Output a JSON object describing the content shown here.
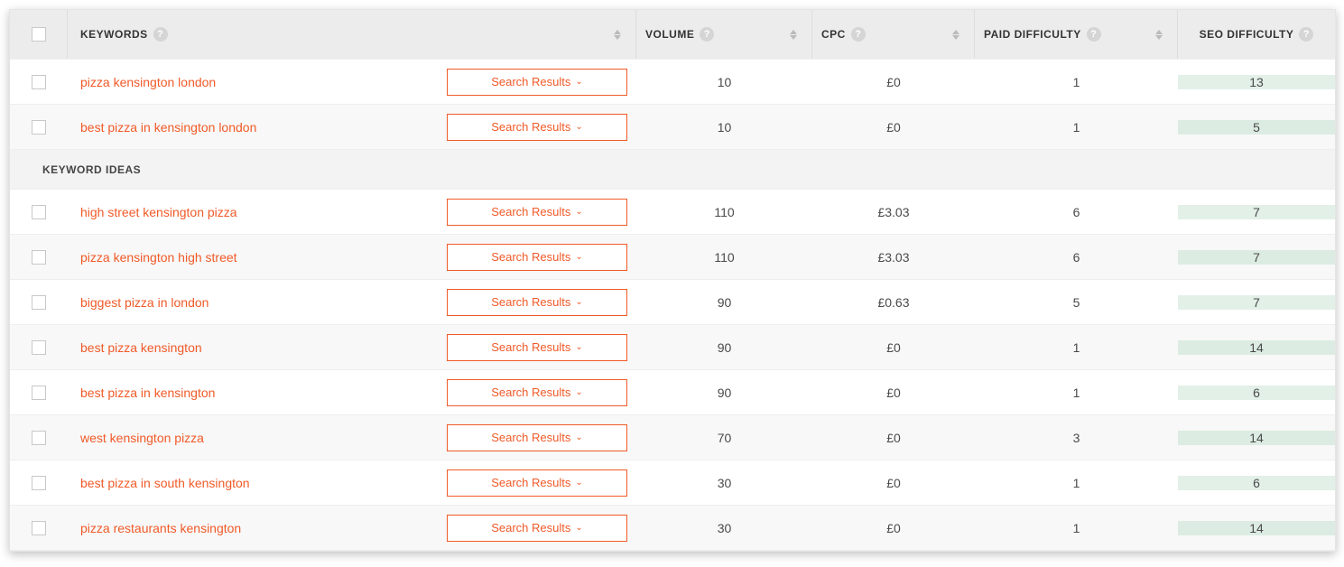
{
  "headers": {
    "keywords": "KEYWORDS",
    "volume": "VOLUME",
    "cpc": "CPC",
    "paid_difficulty": "PAID DIFFICULTY",
    "seo_difficulty": "SEO DIFFICULTY"
  },
  "search_results_label": "Search Results",
  "sections": {
    "keyword_ideas": "KEYWORD IDEAS"
  },
  "main_rows": [
    {
      "keyword": "pizza kensington london",
      "volume": "10",
      "cpc": "£0",
      "paid": "1",
      "seo": "13"
    },
    {
      "keyword": "best pizza in kensington london",
      "volume": "10",
      "cpc": "£0",
      "paid": "1",
      "seo": "5"
    }
  ],
  "idea_rows": [
    {
      "keyword": "high street kensington pizza",
      "volume": "110",
      "cpc": "£3.03",
      "paid": "6",
      "seo": "7"
    },
    {
      "keyword": "pizza kensington high street",
      "volume": "110",
      "cpc": "£3.03",
      "paid": "6",
      "seo": "7"
    },
    {
      "keyword": "biggest pizza in london",
      "volume": "90",
      "cpc": "£0.63",
      "paid": "5",
      "seo": "7"
    },
    {
      "keyword": "best pizza kensington",
      "volume": "90",
      "cpc": "£0",
      "paid": "1",
      "seo": "14"
    },
    {
      "keyword": "best pizza in kensington",
      "volume": "90",
      "cpc": "£0",
      "paid": "1",
      "seo": "6"
    },
    {
      "keyword": "west kensington pizza",
      "volume": "70",
      "cpc": "£0",
      "paid": "3",
      "seo": "14"
    },
    {
      "keyword": "best pizza in south kensington",
      "volume": "30",
      "cpc": "£0",
      "paid": "1",
      "seo": "6"
    },
    {
      "keyword": "pizza restaurants kensington",
      "volume": "30",
      "cpc": "£0",
      "paid": "1",
      "seo": "14"
    }
  ]
}
